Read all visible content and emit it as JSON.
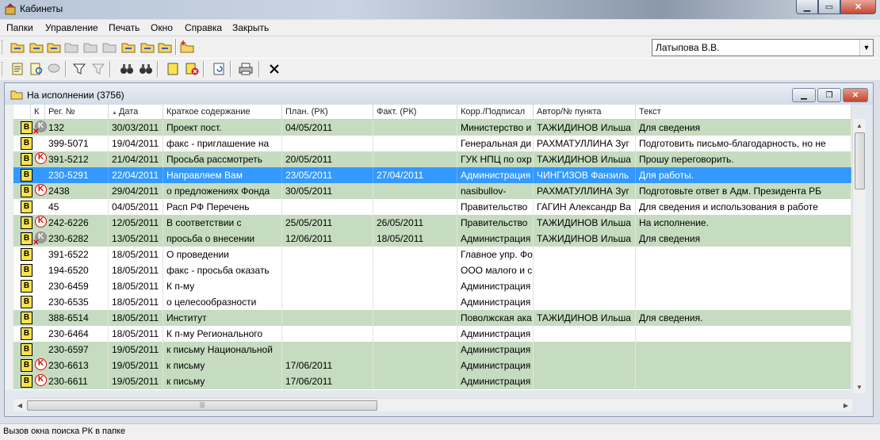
{
  "window": {
    "title": "Кабинеты"
  },
  "menu": [
    "Папки",
    "Управление",
    "Печать",
    "Окно",
    "Справка",
    "Закрыть"
  ],
  "user_combo": {
    "value": "Латыпова В.В."
  },
  "inner_window": {
    "title": "На исполнении (3756)"
  },
  "columns": [
    "К",
    "Рег. №",
    "Дата",
    "Краткое содержание",
    "План. (РК)",
    "Факт. (РК)",
    "Корр./Подписал",
    "Автор/№ пункта",
    "Текст"
  ],
  "rows": [
    {
      "k": "grey",
      "reg": "132",
      "date": "30/03/2011",
      "summary": "Проект пост.",
      "plan": "04/05/2011",
      "fact": "",
      "corr": "Министерство и",
      "author": "ТАЖИДИНОВ Ильша",
      "text": "Для сведения",
      "style": "g"
    },
    {
      "k": "",
      "reg": "399-5071",
      "date": "19/04/2011",
      "summary": "факс - приглашение на",
      "plan": "",
      "fact": "",
      "corr": "Генеральная ди",
      "author": "РАХМАТУЛЛИНА Зуг",
      "text": "Подготовить письмо-благодарность, но не",
      "style": "w"
    },
    {
      "k": "red",
      "reg": "391-5212",
      "date": "21/04/2011",
      "summary": "Просьба рассмотреть",
      "plan": "20/05/2011",
      "fact": "",
      "corr": "ГУК НПЦ по охр",
      "author": "ТАЖИДИНОВ Ильша",
      "text": "Прошу переговорить.",
      "style": "g"
    },
    {
      "k": "",
      "reg": "230-5291",
      "date": "22/04/2011",
      "summary": "Направляем Вам",
      "plan": "23/05/2011",
      "fact": "27/04/2011",
      "corr": "Администрация",
      "author": "ЧИНГИЗОВ Фанзиль",
      "text": "Для работы.",
      "style": "sel"
    },
    {
      "k": "red",
      "reg": "2438",
      "date": "29/04/2011",
      "summary": "о предложениях Фонда",
      "plan": "30/05/2011",
      "fact": "",
      "corr": "nasibullov-",
      "author": "РАХМАТУЛЛИНА Зуг",
      "text": "Подготовьте ответ в Адм. Президента РБ",
      "style": "g"
    },
    {
      "k": "",
      "reg": "45",
      "date": "04/05/2011",
      "summary": "Расп РФ Перечень",
      "plan": "",
      "fact": "",
      "corr": "Правительство",
      "author": "ГАГИН Александр Ва",
      "text": "Для сведения и использования в работе",
      "style": "w"
    },
    {
      "k": "red",
      "reg": "242-6226",
      "date": "12/05/2011",
      "summary": "В соответствии с",
      "plan": "25/05/2011",
      "fact": "26/05/2011",
      "corr": "Правительство",
      "author": "ТАЖИДИНОВ Ильша",
      "text": "На исполнение.",
      "style": "g"
    },
    {
      "k": "grey",
      "reg": "230-6282",
      "date": "13/05/2011",
      "summary": "просьба о внесении",
      "plan": "12/06/2011",
      "fact": "18/05/2011",
      "corr": "Администрация",
      "author": "ТАЖИДИНОВ Ильша",
      "text": "Для сведения",
      "style": "g"
    },
    {
      "k": "",
      "reg": "391-6522",
      "date": "18/05/2011",
      "summary": "О проведении",
      "plan": "",
      "fact": "",
      "corr": "Главное упр. Фо",
      "author": "",
      "text": "",
      "style": "w"
    },
    {
      "k": "",
      "reg": "194-6520",
      "date": "18/05/2011",
      "summary": "факс - просьба оказать",
      "plan": "",
      "fact": "",
      "corr": "ООО малого и с",
      "author": "",
      "text": "",
      "style": "w"
    },
    {
      "k": "",
      "reg": "230-6459",
      "date": "18/05/2011",
      "summary": "К п-му",
      "plan": "",
      "fact": "",
      "corr": "Администрация",
      "author": "",
      "text": "",
      "style": "w"
    },
    {
      "k": "",
      "reg": "230-6535",
      "date": "18/05/2011",
      "summary": "о целесообразности",
      "plan": "",
      "fact": "",
      "corr": "Администрация",
      "author": "",
      "text": "",
      "style": "w"
    },
    {
      "k": "",
      "reg": "388-6514",
      "date": "18/05/2011",
      "summary": "Институт",
      "plan": "",
      "fact": "",
      "corr": "Поволжская ака",
      "author": "ТАЖИДИНОВ Ильша",
      "text": "Для сведения.",
      "style": "g"
    },
    {
      "k": "",
      "reg": "230-6464",
      "date": "18/05/2011",
      "summary": "К п-му Регионального",
      "plan": "",
      "fact": "",
      "corr": "Администрация",
      "author": "",
      "text": "",
      "style": "w"
    },
    {
      "k": "",
      "reg": "230-6597",
      "date": "19/05/2011",
      "summary": "к письму Национальной",
      "plan": "",
      "fact": "",
      "corr": "Администрация",
      "author": "",
      "text": "",
      "style": "g"
    },
    {
      "k": "red",
      "reg": "230-6613",
      "date": "19/05/2011",
      "summary": "к письму",
      "plan": "17/06/2011",
      "fact": "",
      "corr": "Администрация",
      "author": "",
      "text": "",
      "style": "g"
    },
    {
      "k": "red",
      "reg": "230-6611",
      "date": "19/05/2011",
      "summary": "к письму",
      "plan": "17/06/2011",
      "fact": "",
      "corr": "Администрация",
      "author": "",
      "text": "",
      "style": "g"
    }
  ],
  "status": "Вызов окна поиска РК в папке",
  "colors": {
    "green_row": "#c6dcc0",
    "selected_row": "#3399ff"
  }
}
